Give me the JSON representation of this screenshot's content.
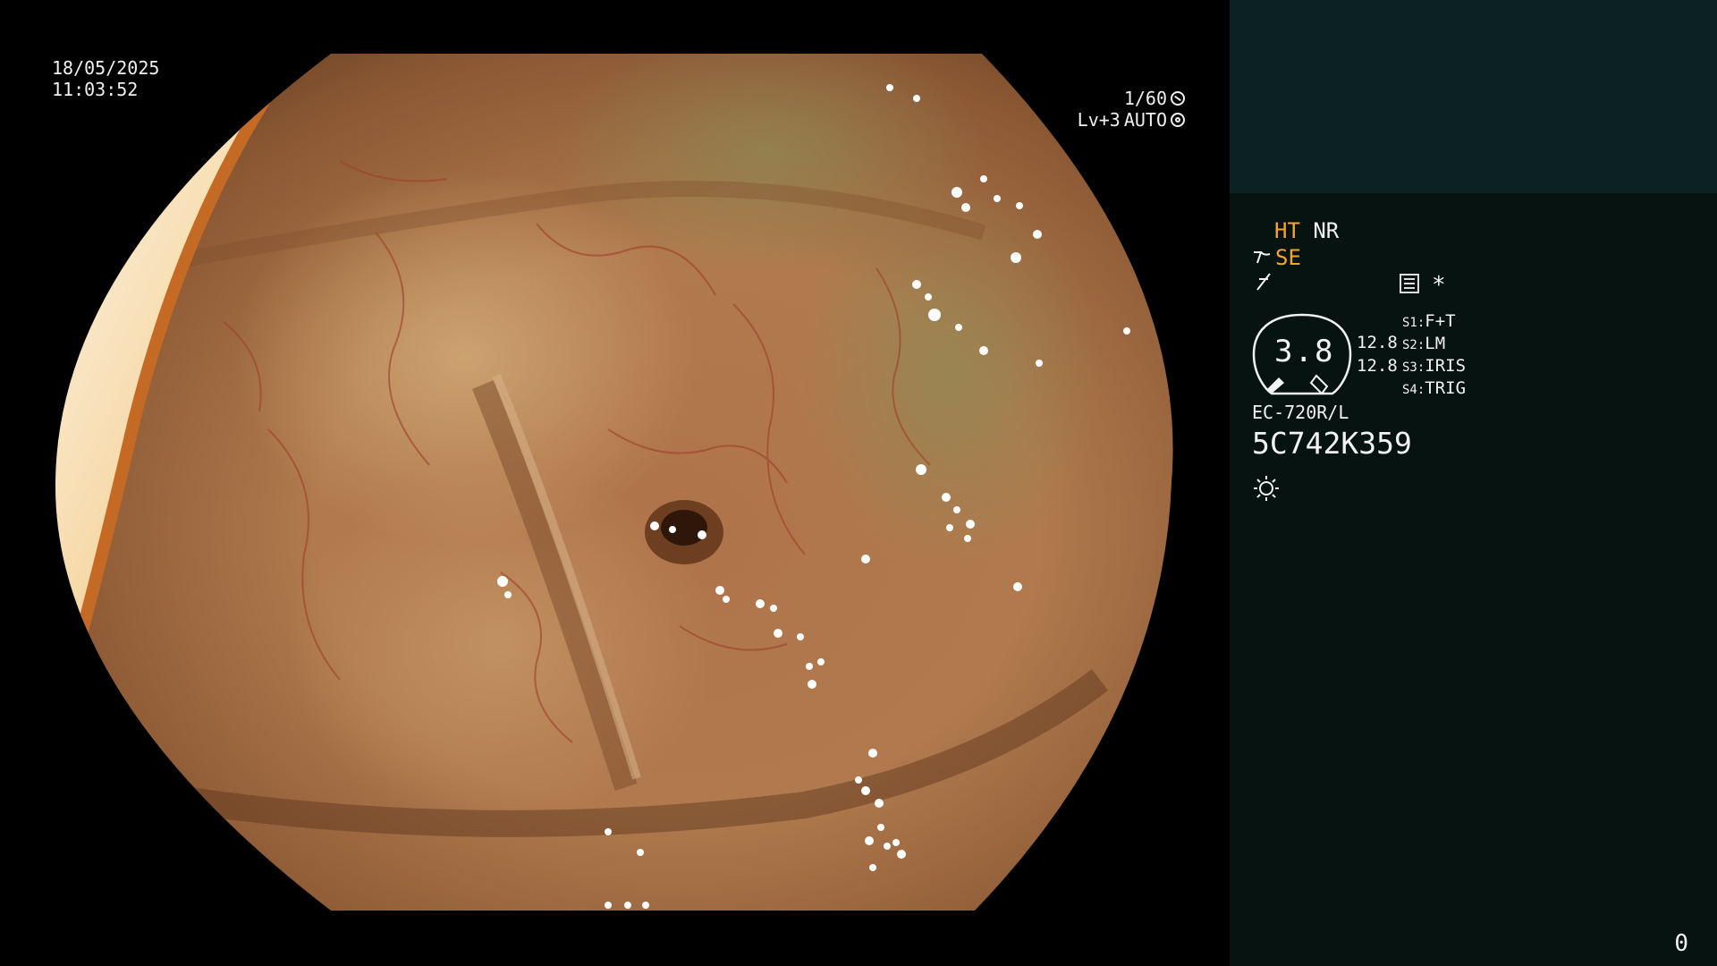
{
  "overlay": {
    "date": "18/05/2025",
    "time": "11:03:52",
    "shutter": "1/60",
    "level": "Lv+3",
    "exposure_mode": "AUTO",
    "shutter_icon": "shutter-icon",
    "iris_icon": "iris-icon"
  },
  "panel": {
    "mode_ht": "HT",
    "mode_nr": "NR",
    "mode_se": "SE",
    "sharpness_icon": "sharpness-icon",
    "menu_icon": "menu-icon",
    "star": "*",
    "zoom": "3.8",
    "level_a": "12.8",
    "level_b": "12.8",
    "switches": [
      {
        "key": "S1:",
        "value": "F+T"
      },
      {
        "key": "S2:",
        "value": "LM"
      },
      {
        "key": "S3:",
        "value": "IRIS"
      },
      {
        "key": "S4:",
        "value": "TRIG"
      }
    ],
    "scope_model": "EC-720R/L",
    "serial": "5C742K359",
    "light_icon": "light-icon",
    "counter": "0"
  },
  "colors": {
    "panel_bg": "#061311",
    "panel_top_bg": "#0c2123",
    "accent": "#f5a623",
    "text": "#f2f2f2"
  }
}
